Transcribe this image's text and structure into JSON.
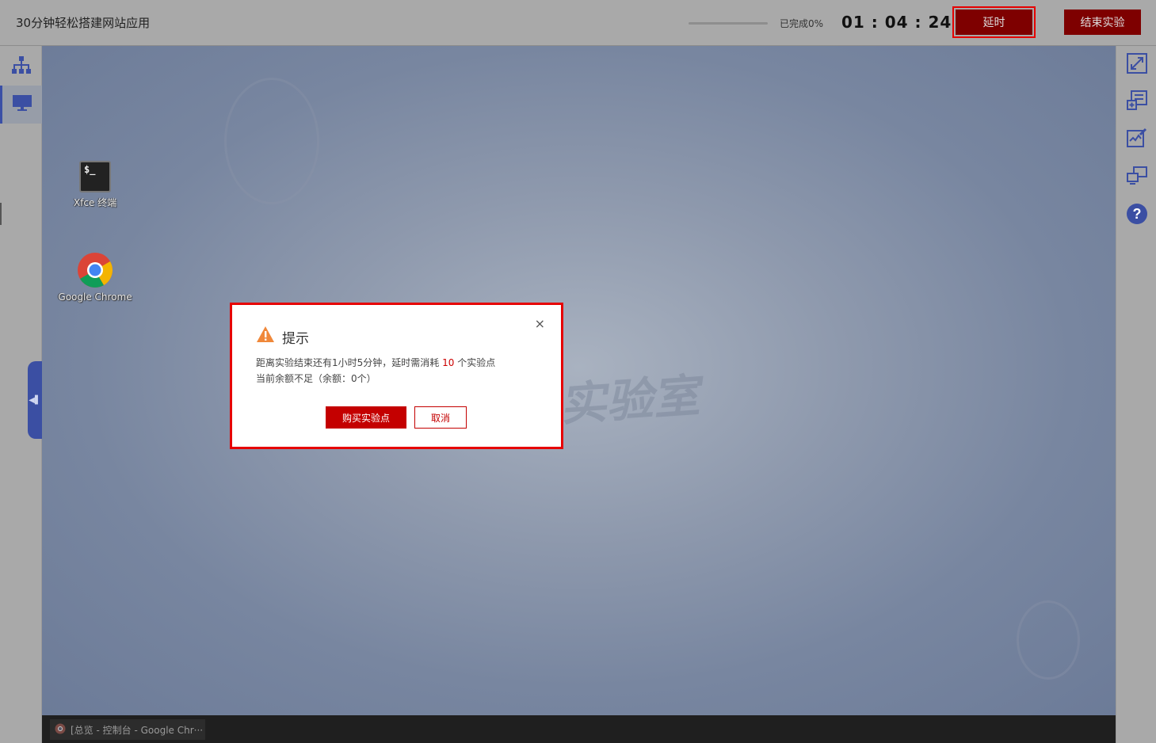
{
  "header": {
    "title": "30分钟轻松搭建网站应用",
    "progress_label": "已完成0%",
    "progress_fraction": 0,
    "timer": "01 : 04 : 24",
    "delay_label": "延时",
    "end_label": "结束实验"
  },
  "left_sidebar": {
    "items": [
      {
        "icon": "topology-icon"
      },
      {
        "icon": "desktop-icon",
        "active": true
      }
    ]
  },
  "right_sidebar": {
    "items": [
      {
        "icon": "fullscreen-icon"
      },
      {
        "icon": "add-screen-icon"
      },
      {
        "icon": "report-icon"
      },
      {
        "icon": "multi-screen-icon"
      },
      {
        "icon": "help-icon"
      }
    ]
  },
  "desktop": {
    "icons": [
      {
        "label": "Xfce 终端",
        "icon": "terminal-icon",
        "glyph": "$_"
      },
      {
        "label": "Google Chrome",
        "icon": "chrome-icon"
      }
    ],
    "taskbar": {
      "item_label": "[总览 - 控制台 - Google Chr···"
    }
  },
  "dialog": {
    "title": "提示",
    "close_glyph": "×",
    "line1_prefix": "距离实验结束还有1小时5分钟，延时需消耗",
    "line1_value": "10",
    "line1_suffix": "个实验点",
    "line2": "当前余额不足（余额：0个）",
    "buy_label": "购买实验点",
    "cancel_label": "取消"
  },
  "colors": {
    "accent_red": "#c40000",
    "dark_red_button": "#7e0000",
    "highlight_border": "#e60000",
    "sidebar_blue": "#3b4fa3"
  }
}
